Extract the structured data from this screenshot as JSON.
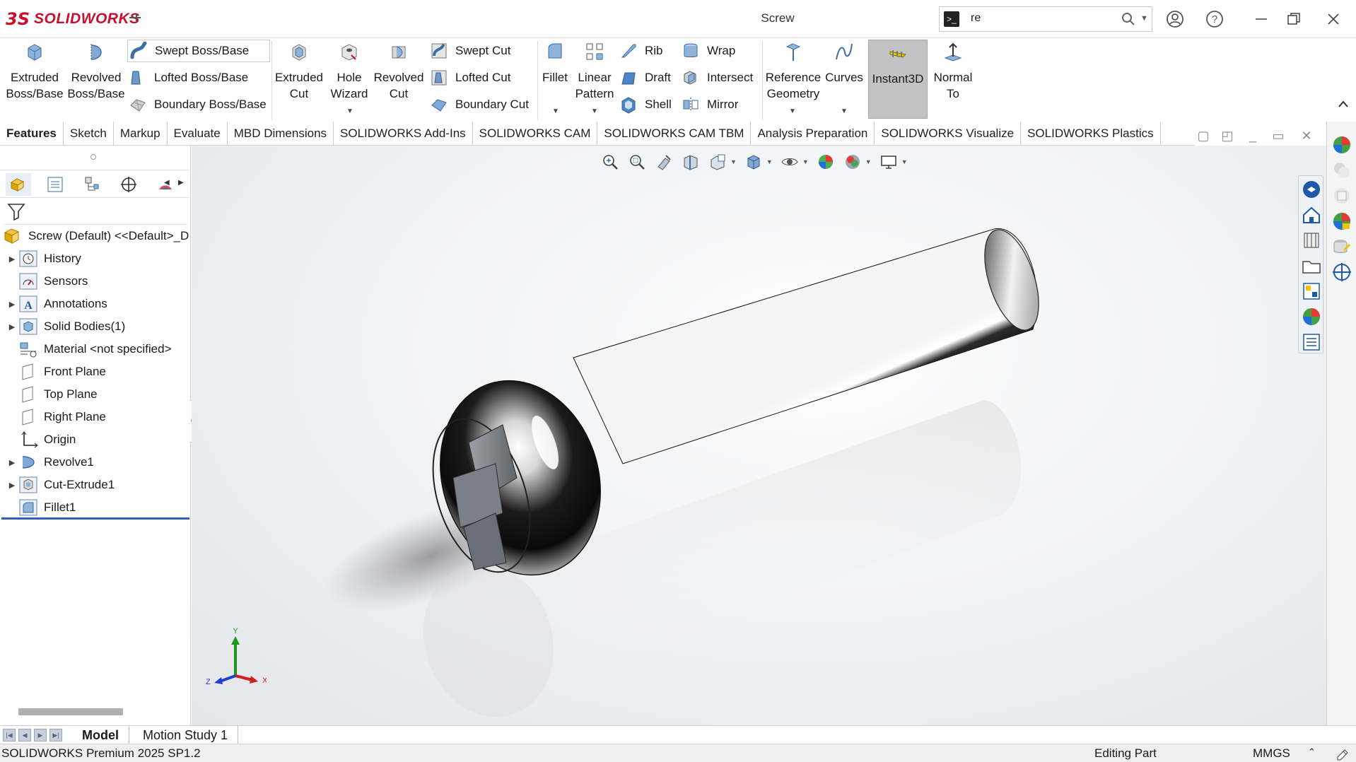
{
  "titlebar": {
    "logo_mark": "3S",
    "brand": "SOLIDWORKS",
    "document_title": "Screw",
    "search_value": "re",
    "search_prompt": ">_"
  },
  "ribbon": {
    "extruded_boss": [
      "Extruded",
      "Boss/Base"
    ],
    "revolved_boss": [
      "Revolved",
      "Boss/Base"
    ],
    "swept_boss": "Swept Boss/Base",
    "lofted_boss": "Lofted Boss/Base",
    "boundary_boss": "Boundary Boss/Base",
    "extruded_cut": [
      "Extruded",
      "Cut"
    ],
    "hole_wizard": [
      "Hole",
      "Wizard"
    ],
    "revolved_cut": [
      "Revolved",
      "Cut"
    ],
    "swept_cut": "Swept Cut",
    "lofted_cut": "Lofted Cut",
    "boundary_cut": "Boundary Cut",
    "fillet": "Fillet",
    "linear_pattern": [
      "Linear",
      "Pattern"
    ],
    "rib": "Rib",
    "draft": "Draft",
    "shell": "Shell",
    "wrap": "Wrap",
    "intersect": "Intersect",
    "mirror": "Mirror",
    "reference_geometry": [
      "Reference",
      "Geometry"
    ],
    "curves": "Curves",
    "instant3d": "Instant3D",
    "normal_to": [
      "Normal",
      "To"
    ]
  },
  "tabs": [
    "Features",
    "Sketch",
    "Markup",
    "Evaluate",
    "MBD Dimensions",
    "SOLIDWORKS Add-Ins",
    "SOLIDWORKS CAM",
    "SOLIDWORKS CAM TBM",
    "Analysis Preparation",
    "SOLIDWORKS Visualize",
    "SOLIDWORKS Plastics"
  ],
  "active_tab": "Features",
  "tree": {
    "root": "Screw (Default) <<Default>_D",
    "items": [
      {
        "label": "History",
        "expandable": true,
        "icon": "history-icon"
      },
      {
        "label": "Sensors",
        "expandable": false,
        "icon": "sensors-icon"
      },
      {
        "label": "Annotations",
        "expandable": true,
        "icon": "annotations-icon"
      },
      {
        "label": "Solid Bodies(1)",
        "expandable": true,
        "icon": "solid-bodies-icon"
      },
      {
        "label": "Material <not specified>",
        "expandable": false,
        "icon": "material-icon"
      },
      {
        "label": "Front Plane",
        "expandable": false,
        "icon": "plane-icon"
      },
      {
        "label": "Top Plane",
        "expandable": false,
        "icon": "plane-icon"
      },
      {
        "label": "Right Plane",
        "expandable": false,
        "icon": "plane-icon"
      },
      {
        "label": "Origin",
        "expandable": false,
        "icon": "origin-icon"
      },
      {
        "label": "Revolve1",
        "expandable": true,
        "icon": "revolve-icon"
      },
      {
        "label": "Cut-Extrude1",
        "expandable": true,
        "icon": "cut-extrude-icon"
      },
      {
        "label": "Fillet1",
        "expandable": false,
        "icon": "fillet-icon"
      }
    ]
  },
  "triad": {
    "y": "Y",
    "x": "X",
    "z": "Z"
  },
  "bottom_tabs": [
    "Model",
    "Motion Study 1"
  ],
  "active_bottom_tab": "Model",
  "status": {
    "product": "SOLIDWORKS Premium 2025 SP1.2",
    "mode": "Editing Part",
    "units": "MMGS",
    "units_arrow": "⌃"
  },
  "colors": {
    "brand_red": "#c8102e",
    "selection_blue": "#2a63b8",
    "instant3d_active": "#c3c3c3"
  }
}
